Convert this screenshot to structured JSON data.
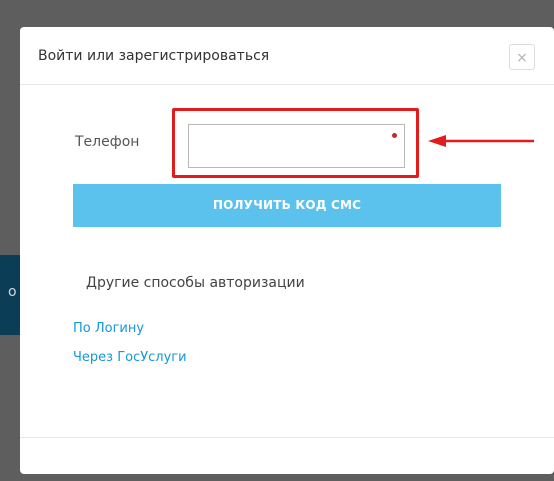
{
  "backdrop": {
    "fragment_text": "o"
  },
  "modal": {
    "title": "Войти или зарегистрироваться",
    "close_label": "×",
    "phone_label": "Телефон",
    "phone_value": "",
    "sms_button_label": "ПОЛУЧИТЬ КОД СМС",
    "other_methods_heading": "Другие способы авторизации",
    "links": {
      "login": "По Логину",
      "gosuslugi": "Через ГосУслуги"
    }
  },
  "colors": {
    "accent_button": "#5bc2ee",
    "link": "#1797d6",
    "annotation_red": "#e21b1b",
    "required_dot": "#c62828"
  }
}
